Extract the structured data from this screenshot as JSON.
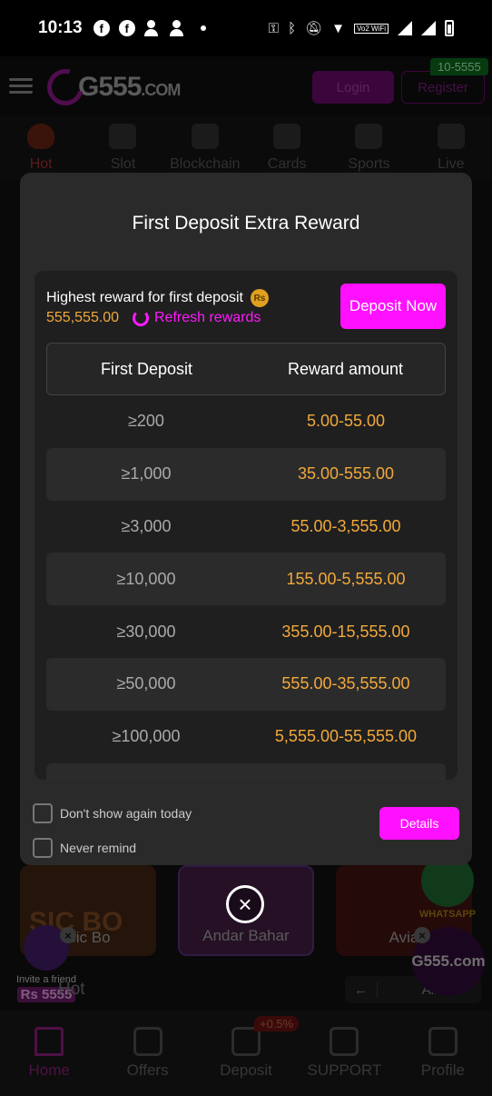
{
  "status_bar": {
    "time": "10:13",
    "wifi_tag": "Vo2 WiFi"
  },
  "header": {
    "logo_main": "G555",
    "logo_suffix": ".COM",
    "login_label": "Login",
    "register_label": "Register",
    "badge": "10-5555"
  },
  "categories": [
    "Hot",
    "Slot",
    "Blockchain",
    "Cards",
    "Sports",
    "Live"
  ],
  "modal": {
    "title": "First Deposit Extra Reward",
    "highest_reward_label": "Highest reward for first deposit",
    "coin_label": "Rs",
    "highest_reward_amount": "555,555.00",
    "refresh_label": "Refresh rewards",
    "deposit_now_label": "Deposit Now",
    "table": {
      "headers": [
        "First Deposit",
        "Reward amount"
      ],
      "rows": [
        [
          "≥200",
          "5.00-55.00"
        ],
        [
          "≥1,000",
          "35.00-555.00"
        ],
        [
          "≥3,000",
          "55.00-3,555.00"
        ],
        [
          "≥10,000",
          "155.00-5,555.00"
        ],
        [
          "≥30,000",
          "355.00-15,555.00"
        ],
        [
          "≥50,000",
          "555.00-35,555.00"
        ],
        [
          "≥100,000",
          "5,555.00-55,555.00"
        ]
      ]
    },
    "dont_show_label": "Don't show again today",
    "never_remind_label": "Never remind",
    "details_label": "Details"
  },
  "background": {
    "games": [
      "Sic Bo",
      "Andar Bahar",
      "Avia"
    ],
    "sicbo_title": "SIC BO",
    "invite_label": "Invite a friend",
    "invite_amount": "Rs 5555",
    "lobby_label": "Hot",
    "filter_label": "All",
    "whatsapp_label": "WHATSAPP",
    "floating_logo": "G555.com"
  },
  "bottom_nav": {
    "items": [
      "Home",
      "Offers",
      "Deposit",
      "SUPPORT",
      "Profile"
    ],
    "deposit_badge": "+0.5%"
  },
  "colors": {
    "accent": "#ff10ff",
    "reward": "#f2a93b",
    "panel": "#2a2a2a"
  }
}
